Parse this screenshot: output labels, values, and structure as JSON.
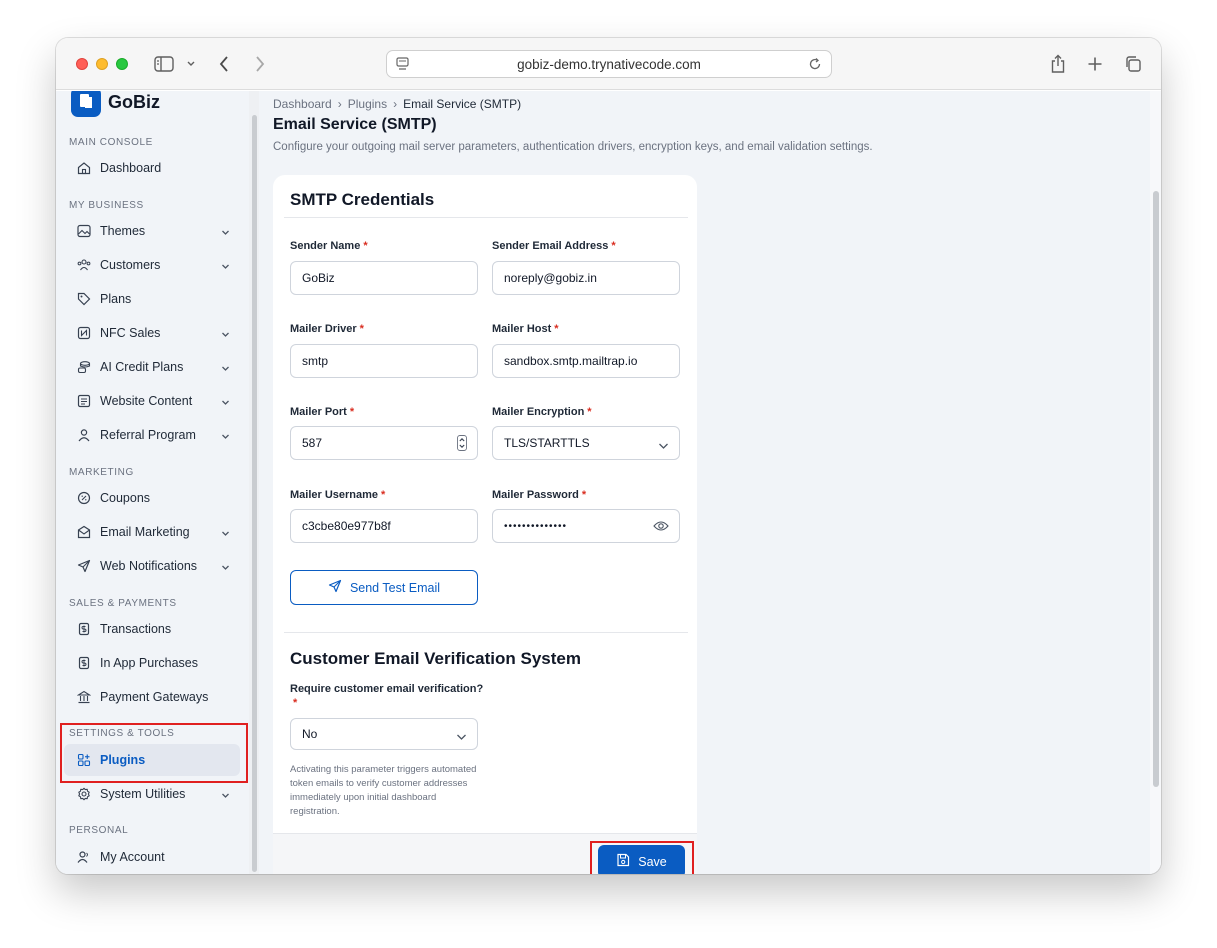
{
  "browser": {
    "url": "gobiz-demo.trynativecode.com"
  },
  "app": {
    "logo_text": "GoBiz"
  },
  "sidebar": {
    "sections": [
      {
        "title": "MAIN CONSOLE"
      },
      {
        "title": "MY BUSINESS"
      },
      {
        "title": "MARKETING"
      },
      {
        "title": "SALES & PAYMENTS"
      },
      {
        "title": "SETTINGS & TOOLS"
      },
      {
        "title": "PERSONAL"
      }
    ],
    "items": [
      {
        "label": "Dashboard",
        "icon": "home-icon"
      },
      {
        "label": "Themes",
        "icon": "image-icon"
      },
      {
        "label": "Customers",
        "icon": "users-icon"
      },
      {
        "label": "Plans",
        "icon": "tag-icon"
      },
      {
        "label": "NFC Sales",
        "icon": "nfc-icon"
      },
      {
        "label": "AI Credit Plans",
        "icon": "coins-icon"
      },
      {
        "label": "Website Content",
        "icon": "document-icon"
      },
      {
        "label": "Referral Program",
        "icon": "user-icon"
      },
      {
        "label": "Coupons",
        "icon": "discount-icon"
      },
      {
        "label": "Email Marketing",
        "icon": "mail-icon"
      },
      {
        "label": "Web Notifications",
        "icon": "send-icon"
      },
      {
        "label": "Transactions",
        "icon": "receipt-icon"
      },
      {
        "label": "In App Purchases",
        "icon": "receipt-icon"
      },
      {
        "label": "Payment Gateways",
        "icon": "bank-icon"
      },
      {
        "label": "Plugins",
        "icon": "apps-icon"
      },
      {
        "label": "System Utilities",
        "icon": "gear-icon"
      },
      {
        "label": "My Account",
        "icon": "account-icon"
      }
    ]
  },
  "breadcrumb": {
    "items": [
      "Dashboard",
      "Plugins",
      "Email Service (SMTP)"
    ],
    "separator": "›"
  },
  "page": {
    "title": "Email Service (SMTP)",
    "description": "Configure your outgoing mail server parameters, authentication drivers, encryption keys, and email validation settings."
  },
  "smtp": {
    "heading": "SMTP Credentials",
    "required_mark": "*",
    "sender_name_label": "Sender Name",
    "sender_name_value": "GoBiz",
    "sender_email_label": "Sender Email Address",
    "sender_email_value": "noreply@gobiz.in",
    "driver_label": "Mailer Driver",
    "driver_value": "smtp",
    "host_label": "Mailer Host",
    "host_value": "sandbox.smtp.mailtrap.io",
    "port_label": "Mailer Port",
    "port_value": "587",
    "encryption_label": "Mailer Encryption",
    "encryption_value": "TLS/STARTTLS",
    "username_label": "Mailer Username",
    "username_value": "c3cbe80e977b8f",
    "password_label": "Mailer Password",
    "password_value": "••••••••••••••",
    "test_button": "Send Test Email"
  },
  "verification": {
    "heading": "Customer Email Verification System",
    "question_label": "Require customer email verification?",
    "required_mark": "*",
    "value": "No",
    "help": "Activating this parameter triggers automated token emails to verify customer addresses immediately upon initial dashboard registration."
  },
  "actions": {
    "save": "Save"
  },
  "colors": {
    "accent": "#0a5cc2",
    "highlight": "#e02020",
    "sidebar_bg": "#f1f4f8"
  }
}
